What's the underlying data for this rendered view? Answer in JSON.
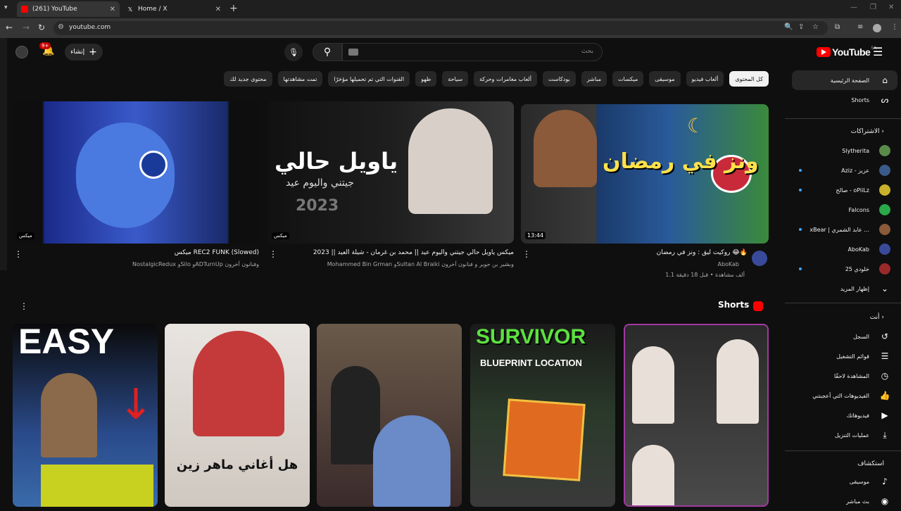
{
  "browser": {
    "tabs": [
      {
        "title": "(261) YouTube",
        "active": true
      },
      {
        "title": "Home / X",
        "active": false
      }
    ],
    "url": "youtube.com"
  },
  "header": {
    "logo_text": "YouTube",
    "region": "SA",
    "search_placeholder": "بحث",
    "create_label": "إنشاء",
    "notification_count": "9+"
  },
  "chips": [
    "كل المحتوى",
    "ألعاب فيديو",
    "موسيقى",
    "ميكسات",
    "مباشر",
    "بودكاست",
    "ألعاب مغامرات وحركة",
    "سياحة",
    "طهو",
    "القنوات التي تم تحميلها مؤخرًا",
    "تمت مشاهدتها",
    "محتوى جديد لك"
  ],
  "sidebar": {
    "main": [
      {
        "label": "الصفحة الرئيسية",
        "icon": "home-icon",
        "active": true
      },
      {
        "label": "Shorts",
        "icon": "shorts-icon",
        "active": false
      }
    ],
    "subscriptions_header": "الاشتراكات",
    "subscriptions": [
      {
        "label": "Slytherita",
        "color": "#5a8a4a",
        "dot": false
      },
      {
        "label": "Aziz - عزيز",
        "color": "#3a5a8a",
        "dot": true
      },
      {
        "label": "صالح - oPiiLz",
        "color": "#c9b22a",
        "dot": true
      },
      {
        "label": "Falcons",
        "color": "#2aa84a",
        "dot": false
      },
      {
        "label": "xBear | عابد الشمري ...",
        "color": "#8a5a3a",
        "dot": true
      },
      {
        "label": "AboKab",
        "color": "#3a4a9a",
        "dot": false
      },
      {
        "label": "خلودي 25",
        "color": "#9a2a2a",
        "dot": true
      },
      {
        "label": "إظهار المزيد",
        "color": "",
        "dot": false
      }
    ],
    "you_header": "أنت",
    "you": [
      {
        "label": "السجل",
        "icon": "history-icon"
      },
      {
        "label": "قوائم التشغيل",
        "icon": "playlist-icon"
      },
      {
        "label": "المشاهدة لاحقًا",
        "icon": "clock-icon"
      },
      {
        "label": "الفيديوهات التي أعجبتني",
        "icon": "like-icon"
      },
      {
        "label": "فيديوهاتك",
        "icon": "video-icon"
      },
      {
        "label": "عمليات التنزيل",
        "icon": "download-icon"
      }
    ],
    "explore_header": "استكشاف",
    "explore": [
      {
        "label": "موسيقى",
        "icon": "music-icon"
      },
      {
        "label": "بث مباشر",
        "icon": "live-icon"
      }
    ]
  },
  "videos": [
    {
      "title": "روكيت ليق : ونز في رمضان 😂🔥",
      "channel": "AboKab",
      "meta": "1.1 ألف مشاهدة • قبل 18 دقيقة",
      "duration": "13:44",
      "thumb_text": "ونز في رمضان"
    },
    {
      "title": "ميكس ياويل حالي جيتني واليوم عيد || محمد بن غرمان - شيلة العيد || 2023",
      "channel": "Mohammed Bin Grman وSultan Al Braiki وبشير بن حوير و فنانون آخرون",
      "badge": "ميكس",
      "thumb_text": "ياويل حالي",
      "thumb_sub": "جيتني واليوم عيد",
      "thumb_year": "2023"
    },
    {
      "title": "ميكس REC2 FUNK (Slowed)",
      "channel": "NostalgicRedux وSilo وADTurnUp وفنانون آخرون",
      "badge": "ميكس"
    }
  ],
  "shorts": {
    "title": "Shorts",
    "items": [
      {
        "text": "EASY"
      },
      {
        "text": "هل أغاني ماهر زين"
      },
      {
        "text": ""
      },
      {
        "text": "SURVIVOR",
        "sub": "BLUEPRINT LOCATION"
      },
      {
        "text": ""
      }
    ]
  },
  "colors": {
    "accent": "#ff0000",
    "bg": "#0f0f0f",
    "chip": "#272727"
  }
}
